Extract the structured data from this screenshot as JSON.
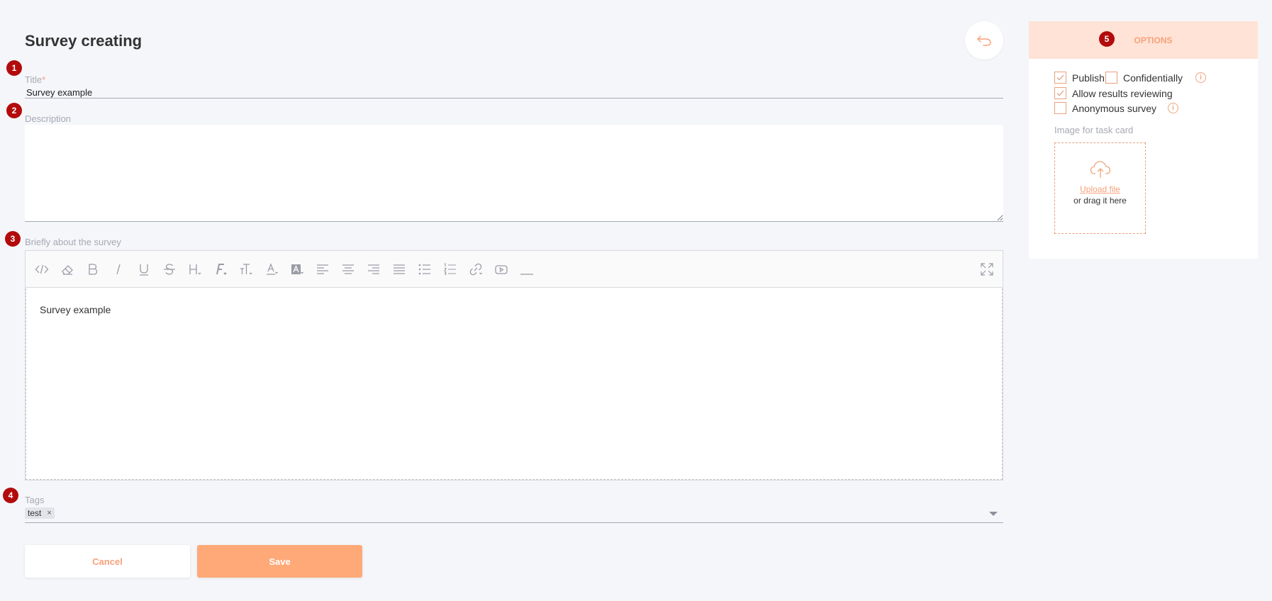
{
  "header": {
    "title": "Survey creating"
  },
  "badges": [
    "1",
    "2",
    "3",
    "4",
    "5"
  ],
  "title_field": {
    "label": "Title",
    "required_mark": "*",
    "value": "Survey example"
  },
  "description_field": {
    "label": "Description",
    "value": ""
  },
  "about_field": {
    "label": "Briefly about the survey",
    "content": "Survey example",
    "toolbar": [
      "code-view-icon",
      "eraser-icon",
      "bold-icon",
      "italic-icon",
      "underline-icon",
      "strikethrough-icon",
      "heading-icon",
      "font-family-icon",
      "font-size-icon",
      "text-color-icon",
      "highlight-icon",
      "align-left-icon",
      "align-center-icon",
      "align-right-icon",
      "align-justify-icon",
      "bullet-list-icon",
      "numbered-list-icon",
      "link-icon",
      "video-icon",
      "horizontal-rule-icon",
      "fullscreen-icon"
    ]
  },
  "tags_field": {
    "label": "Tags",
    "tags": [
      "test"
    ],
    "remove_glyph": "×"
  },
  "actions": {
    "cancel_label": "Cancel",
    "save_label": "Save"
  },
  "options": {
    "header": "OPTIONS",
    "publish": {
      "label": "Publish",
      "checked": true
    },
    "confidentially": {
      "label": "Confidentially",
      "checked": false
    },
    "allow_results": {
      "label": "Allow results reviewing",
      "checked": true
    },
    "anonymous": {
      "label": "Anonymous survey",
      "checked": false
    },
    "info_glyph": "i",
    "image_label": "Image for task card",
    "upload_link": "Upload file",
    "drag_text": "or drag it here"
  },
  "colors": {
    "accent": "#f7a17a",
    "accent_fill": "#ffa878",
    "badge": "#b30b0b",
    "panel_header": "#ffe3d6",
    "background": "#f5f6fa"
  }
}
